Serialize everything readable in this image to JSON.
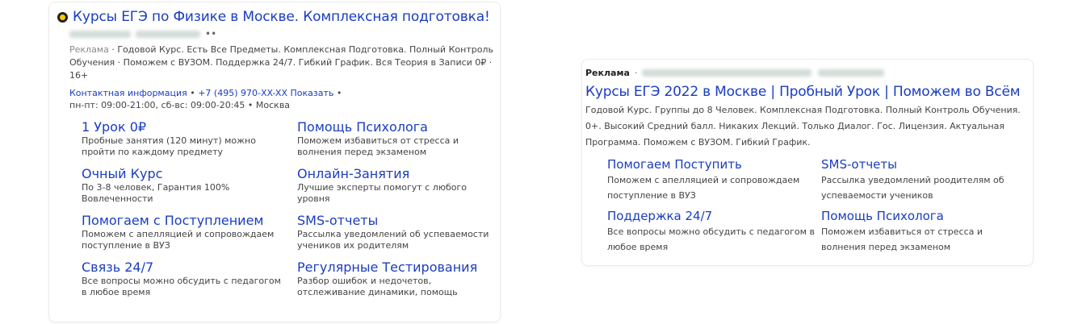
{
  "left_ad": {
    "title": "Курсы ЕГЭ по Физике в Москве. Комплексная подготовка!",
    "dots": "••",
    "ad_label": "Реклама",
    "description": " · Годовой Курс. Есть Все Предметы. Комплексная Подготовка. Полный Контроль Обучения · Поможем с ВУЗОМ. Поддержка 24/7. Гибкий График. Вся Теория в Записи 0₽ · 16+",
    "contact_link": "Контактная информация",
    "sep1": " • ",
    "phone": "+7 (495) 970-XX-XX",
    "show_link": "Показать",
    "sep2": " •",
    "hours": "пн-пт: 09:00-21:00, сб-вс: 09:00-20:45",
    "sep3": " • ",
    "city": "Москва",
    "sitelinks": [
      {
        "title": "1 Урок 0₽",
        "desc": "Пробные занятия (120 минут) можно пройти по каждому предмету"
      },
      {
        "title": "Помощь Психолога",
        "desc": "Поможем избавиться от стресса и волнения перед экзаменом"
      },
      {
        "title": "Очный Курс",
        "desc": "По 3-8 человек, Гарантия 100% Вовлеченности"
      },
      {
        "title": "Онлайн-Занятия",
        "desc": "Лучшие эксперты помогут с любого уровня"
      },
      {
        "title": "Помогаем с Поступлением",
        "desc": "Поможем с апелляцией и сопровождаем поступление в ВУЗ"
      },
      {
        "title": "SMS-отчеты",
        "desc": "Рассылка уведомлений об успеваемости учеников их родителям"
      },
      {
        "title": "Связь 24/7",
        "desc": "Все вопросы можно обсудить с педагогом в любое время"
      },
      {
        "title": "Регулярные Тестирования",
        "desc": "Разбор ошибок и недочетов, отслеживание динамики, помощь"
      }
    ]
  },
  "right_ad": {
    "ad_label": "Реклама",
    "dot": "·",
    "title": "Курсы ЕГЭ 2022 в Москве | Пробный Урок | Поможем во Всём",
    "description": "Годовой Курс. Группы до 8 Человек. Комплексная Подготовка. Полный Контроль Обучения. 0+. Высокий Средний балл. Никаких Лекций. Только Диалог. Гос. Лицензия. Актуальная Программа. Поможем с ВУЗОМ. Гибкий График.",
    "sitelinks": [
      {
        "title": "Помогаем Поступить",
        "desc": "Поможем с апелляцией и сопровождаем поступление в ВУЗ"
      },
      {
        "title": "SMS-отчеты",
        "desc": "Рассылка уведомлений роодителям об успеваемости учеников"
      },
      {
        "title": "Поддержка 24/7",
        "desc": "Все вопросы можно обсудить с педагогом в любое время"
      },
      {
        "title": "Помощь Психолога",
        "desc": "Поможем избавиться от стресса и волнения перед экзаменом"
      }
    ]
  }
}
